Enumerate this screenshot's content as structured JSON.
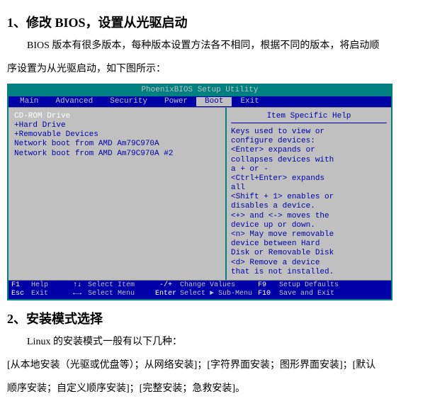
{
  "section1": {
    "heading": "1、修改 BIOS，设置从光驱启动",
    "para1": "BIOS 版本有很多版本，每种版本设置方法各不相同，根据不同的版本，将启动顺",
    "para2": "序设置为从光驱启动，如下图所示："
  },
  "bios": {
    "title": "PhoenixBIOS Setup Utility",
    "menus": [
      "Main",
      "Advanced",
      "Security",
      "Power",
      "Boot",
      "Exit"
    ],
    "boot_items": [
      {
        "label": "CD-ROM Drive",
        "cls": "active"
      },
      {
        "label": "+Hard Drive",
        "cls": "inactive"
      },
      {
        "label": "+Removable Devices",
        "cls": "inactive"
      },
      {
        "label": " Network boot from AMD Am79C970A",
        "cls": "inactive"
      },
      {
        "label": " Network boot from AMD Am79C970A #2",
        "cls": "inactive"
      }
    ],
    "help_title": "Item Specific Help",
    "help_text": [
      "Keys used to view or",
      "configure devices:",
      "<Enter> expands or",
      "collapses devices with",
      "a + or -",
      "<Ctrl+Enter> expands",
      "all",
      "<Shift + 1> enables or",
      "disables a device.",
      "<+> and <-> moves the",
      "device up or down.",
      "<n> May move removable",
      "device between Hard",
      "Disk or Removable Disk",
      "<d> Remove a device",
      "that is not installed."
    ],
    "footer": {
      "row1": {
        "k1": "F1",
        "l1": "Help",
        "s1": "↑↓",
        "la1": "Select Item",
        "s2": "-/+",
        "lb1": "Change Values",
        "k2": "F9",
        "l2": "Setup Defaults"
      },
      "row2": {
        "k1": "Esc",
        "l1": "Exit",
        "s1": "←→",
        "la1": "Select Menu",
        "s2": "Enter",
        "lb1": "Select ► Sub-Menu",
        "k2": "F10",
        "l2": "Save and Exit"
      }
    }
  },
  "section2": {
    "heading": "2、安装模式选择",
    "para1": "Linux 的安装模式一般有以下几种：",
    "para2": "[从本地安装（光驱或优盘等）；从网络安装]；[字符界面安装；图形界面安装]；[默认",
    "para3": "顺序安装；自定义顺序安装]；[完整安装；急救安装]。"
  }
}
